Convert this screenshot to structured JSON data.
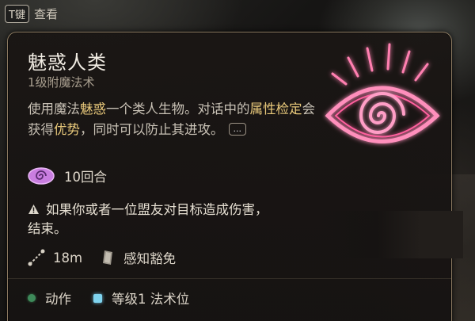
{
  "keyhint": {
    "key": "T键",
    "label": "查看"
  },
  "spell": {
    "name": "魅惑人类",
    "level_school": "1级附魔法术",
    "desc": {
      "p1": "使用魔法",
      "h1": "魅惑",
      "p2": "一个类人生物。对话中的",
      "h2": "属性检定",
      "p3": "会获得",
      "h3": "优势",
      "p4": "，同时可以防止其进攻。"
    },
    "more_label": "...",
    "duration": "10回合",
    "warning": "如果你或者一位盟友对目标造成伤害，",
    "warning_end": "结束。",
    "range": "18m",
    "save": "感知豁免",
    "cost_action": "动作",
    "cost_slot": "等级1 法术位"
  },
  "colors": {
    "highlight": "#e9c97b",
    "border": "#8c7a61",
    "spell_glow": "#ff6fa8",
    "action_dot": "#3e8a5a",
    "slot_square": "#7fd3ee"
  }
}
